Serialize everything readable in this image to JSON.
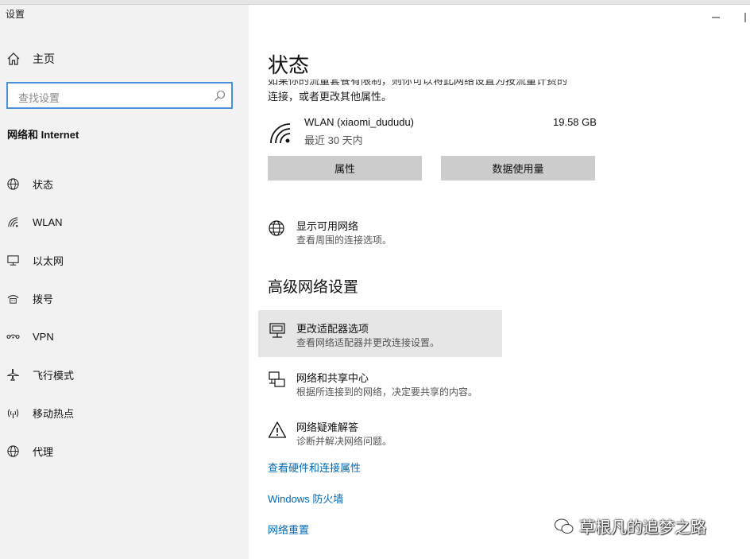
{
  "window": {
    "title": "设置"
  },
  "sidebar": {
    "home_label": "主页",
    "search_placeholder": "查找设置",
    "section_title": "网络和 Internet",
    "items": [
      {
        "label": "状态",
        "icon": "globe-icon"
      },
      {
        "label": "WLAN",
        "icon": "wifi-icon"
      },
      {
        "label": "以太网",
        "icon": "ethernet-icon"
      },
      {
        "label": "拨号",
        "icon": "dialup-icon"
      },
      {
        "label": "VPN",
        "icon": "vpn-icon"
      },
      {
        "label": "飞行模式",
        "icon": "airplane-icon"
      },
      {
        "label": "移动热点",
        "icon": "hotspot-icon"
      },
      {
        "label": "代理",
        "icon": "globe-icon"
      }
    ]
  },
  "main": {
    "title": "状态",
    "clipped_text": "如果你的流量套餐有限制，则你可以将此网络设置为按流量计费的",
    "clipped_text_line2": "连接，或者更改其他属性。",
    "connection": {
      "name": "WLAN (xiaomi_dududu)",
      "period": "最近 30 天内",
      "usage": "19.58 GB"
    },
    "buttons": {
      "properties": "属性",
      "data_usage": "数据使用量"
    },
    "show_networks": {
      "title": "显示可用网络",
      "subtitle": "查看周围的连接选项。"
    },
    "advanced_title": "高级网络设置",
    "adapter": {
      "title": "更改适配器选项",
      "subtitle": "查看网络适配器并更改连接设置。"
    },
    "sharing": {
      "title": "网络和共享中心",
      "subtitle": "根据所连接到的网络，决定要共享的内容。"
    },
    "troubleshoot": {
      "title": "网络疑难解答",
      "subtitle": "诊断并解决网络问题。"
    },
    "links": [
      "查看硬件和连接属性",
      "Windows 防火墙",
      "网络重置"
    ]
  },
  "watermark": "草根凡的追梦之路"
}
